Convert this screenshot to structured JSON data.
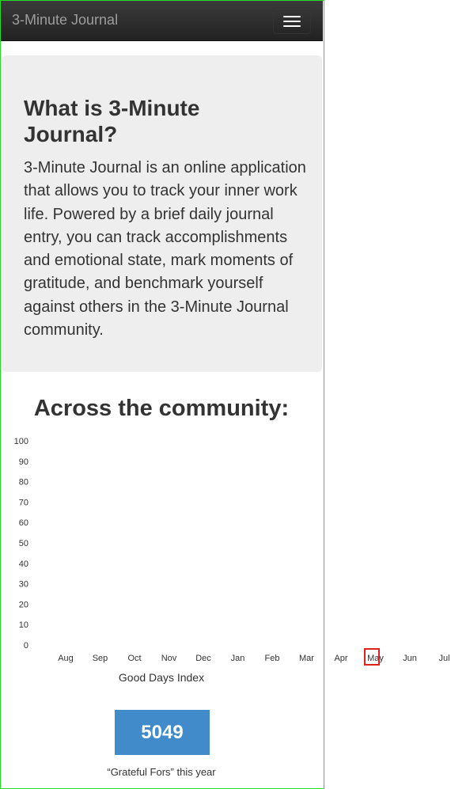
{
  "navbar": {
    "brand": "3-Minute Journal",
    "menu_icon": "hamburger-icon"
  },
  "jumbotron": {
    "title": "What is 3-Minute Journal?",
    "body": "3-Minute Journal is an online application that allows you to track your inner work life. Powered by a brief daily journal entry, you can track accomplishments and emotional state, mark moments of gratitude, and benchmark yourself against others in the 3-Minute Journal community."
  },
  "community": {
    "title": "Across the community:",
    "stat_value": "5049",
    "stat_caption": "“Grateful Fors” this year"
  },
  "chart_data": {
    "type": "line",
    "title": "",
    "xlabel": "Good Days Index",
    "ylabel": "",
    "categories": [
      "Aug",
      "Sep",
      "Oct",
      "Nov",
      "Dec",
      "Jan",
      "Feb",
      "Mar",
      "Apr",
      "May",
      "Jun",
      "Jul"
    ],
    "yticks": [
      "0",
      "10",
      "20",
      "30",
      "40",
      "50",
      "60",
      "70",
      "80",
      "90",
      "100"
    ],
    "ylim": [
      0,
      100
    ],
    "series": [],
    "grid": false,
    "highlighted_category": "May"
  }
}
